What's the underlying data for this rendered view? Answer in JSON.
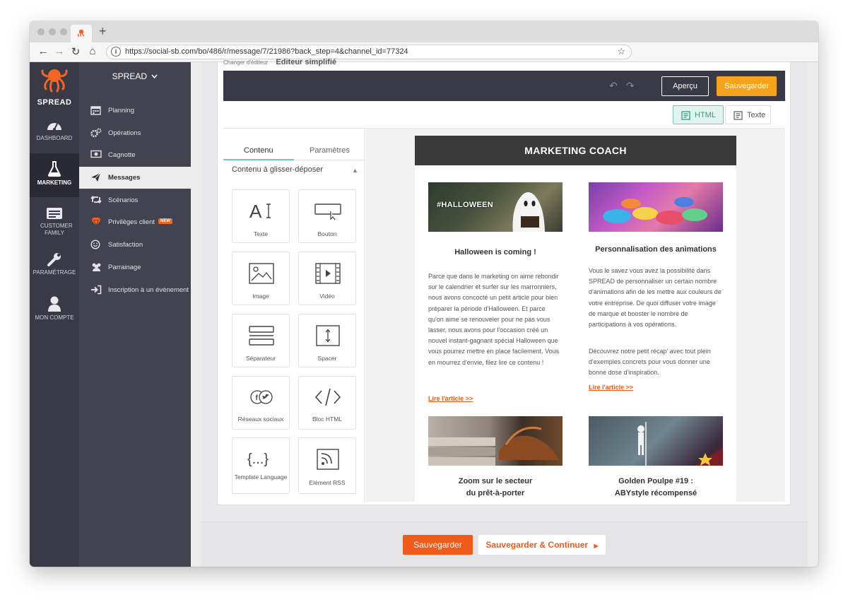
{
  "browser": {
    "url": "https://social-sb.com/bo/486/r/message/7/21986?back_step=4&channel_id=77324",
    "new_tab": "+"
  },
  "brand": {
    "name": "SPREAD",
    "accent": "#f26522"
  },
  "main_nav": [
    {
      "label": "DASHBOARD",
      "icon": "dashboard-icon"
    },
    {
      "label": "MARKETING",
      "icon": "flask-icon",
      "active": true
    },
    {
      "label": "CUSTOMER FAMILY",
      "icon": "id-card-icon"
    },
    {
      "label": "PARAMÉTRAGE",
      "icon": "wrench-icon"
    },
    {
      "label": "MON COMPTE",
      "icon": "user-icon"
    }
  ],
  "sub_nav": {
    "header": "SPREAD",
    "items": [
      {
        "label": "Planning",
        "icon": "calendar-icon"
      },
      {
        "label": "Opérations",
        "icon": "gears-icon"
      },
      {
        "label": "Cagnotte",
        "icon": "money-icon"
      },
      {
        "label": "Messages",
        "icon": "paper-plane-icon",
        "active": true
      },
      {
        "label": "Scénarios",
        "icon": "retweet-icon"
      },
      {
        "label": "Privilèges client",
        "icon": "diamond-icon",
        "badge": "NEW"
      },
      {
        "label": "Satisfaction",
        "icon": "smile-icon"
      },
      {
        "label": "Parrainage",
        "icon": "users-icon"
      },
      {
        "label": "Inscription à un évènement",
        "icon": "sign-in-icon"
      }
    ]
  },
  "editor": {
    "crumb_left": "Changer d'éditeur",
    "crumb_title": "Editeur simplifié",
    "toolbar": {
      "preview": "Aperçu",
      "save": "Sauvegarder"
    },
    "modes": {
      "html": "HTML",
      "text": "Texte"
    },
    "panel": {
      "tabs": [
        "Contenu",
        "Paramètres"
      ],
      "section": "Contenu à glisser-déposer",
      "blocks": [
        "Texte",
        "Bouton",
        "Image",
        "Vidéo",
        "Séparateur",
        "Spacer",
        "Réseaux sociaux",
        "Bloc HTML",
        "Template Language",
        "Elément RSS"
      ]
    },
    "email": {
      "header": "MARKETING COACH",
      "card1": {
        "title": "Halloween is coming !",
        "body": "Parce que dans le marketing on aime rebondir sur le calendrier et surfer sur les marronniers, nous avons concocté un petit article pour bien préparer la période d'Halloween. Et parce qu'on aime se renouveler pour ne pas vous lasser, nous avons pour l'occasion créé un nouvel instant-gagnant spécial Halloween que vous pourrez mettre en place facilement. Vous en mourrez d'envie, filez lire ce contenu !",
        "link": "Lire l'article >>",
        "image_text": "#HALLOWEEN"
      },
      "card2": {
        "title": "Personnalisation des animations",
        "body1": "Vous le savez vous avez la possibilité dans SPREAD de personnaliser un certain nombre d'animations afin de les mettre aux couleurs de votre entreprise. De quoi diffuser votre image de marque et booster le nombre de participations à vos opérations.",
        "body2": "Découvrez notre petit récap' avec tout plein d'exemples concrets pour vous donner une bonne dose d'inspiration.",
        "link": "Lire l'article >>"
      },
      "card3": {
        "title_l1": "Zoom sur le secteur",
        "title_l2": "du prêt-à-porter"
      },
      "card4": {
        "title_l1": "Golden Poulpe #19 :",
        "title_l2": "ABYstyle récompensé"
      }
    },
    "footer": {
      "save": "Sauvegarder",
      "save_continue": "Sauvegarder & Continuer"
    }
  }
}
